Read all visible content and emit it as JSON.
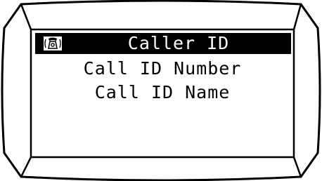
{
  "screen": {
    "title": "Caller ID",
    "title_icon": "ringing-phone-icon",
    "menu_items": [
      {
        "label": "Call ID Number",
        "selected": false
      },
      {
        "label": "Call ID Name",
        "selected": false
      }
    ]
  },
  "colors": {
    "background": "#ffffff",
    "foreground": "#000000",
    "title_bar": "#000000",
    "title_text": "#ffffff"
  }
}
